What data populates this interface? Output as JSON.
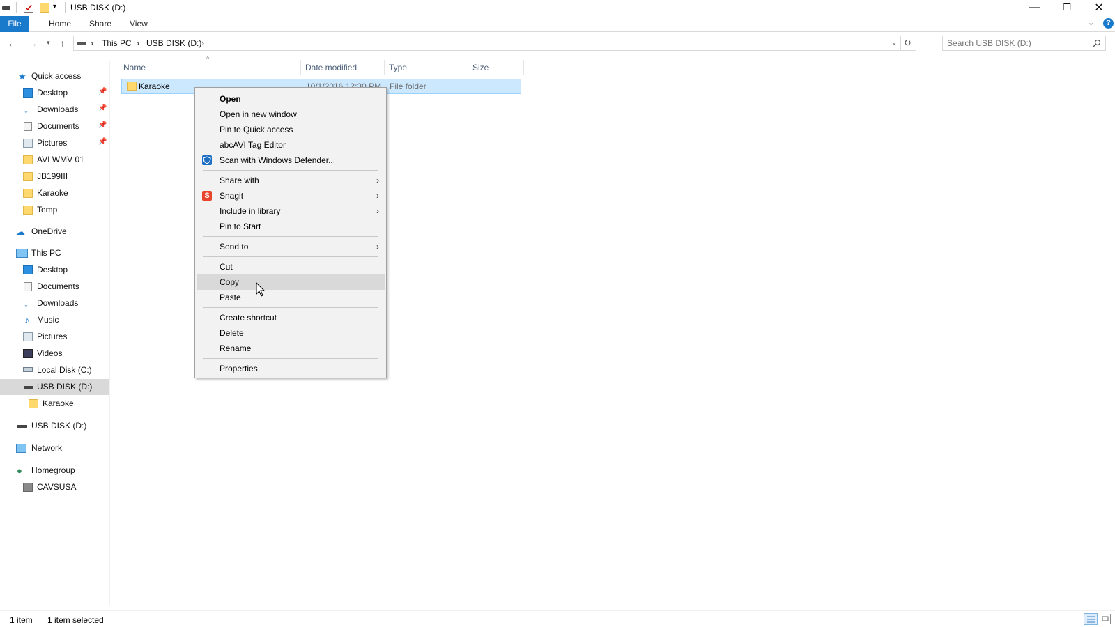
{
  "window": {
    "title": "USB DISK (D:)",
    "minimize": "—",
    "restore": "❐",
    "close": "✕"
  },
  "ribbon": {
    "tabs": [
      "File",
      "Home",
      "Share",
      "View"
    ],
    "help": "?"
  },
  "address": {
    "crumbs": [
      "This PC",
      "USB DISK (D:)"
    ],
    "separator": "›",
    "search_placeholder": "Search USB DISK (D:)"
  },
  "nav": {
    "quick_access": {
      "label": "Quick access",
      "items": [
        {
          "label": "Desktop",
          "icon": "desktop-icon",
          "pinned": true
        },
        {
          "label": "Downloads",
          "icon": "downloads-icon",
          "pinned": true
        },
        {
          "label": "Documents",
          "icon": "documents-icon",
          "pinned": true
        },
        {
          "label": "Pictures",
          "icon": "pictures-icon",
          "pinned": true
        },
        {
          "label": "AVI WMV 01",
          "icon": "folder-icon",
          "pinned": false
        },
        {
          "label": "JB199III",
          "icon": "folder-icon",
          "pinned": false
        },
        {
          "label": "Karaoke",
          "icon": "folder-icon",
          "pinned": false
        },
        {
          "label": "Temp",
          "icon": "folder-icon",
          "pinned": false
        }
      ]
    },
    "onedrive": "OneDrive",
    "this_pc": {
      "label": "This PC",
      "items": [
        {
          "label": "Desktop",
          "icon": "desktop-icon"
        },
        {
          "label": "Documents",
          "icon": "documents-icon"
        },
        {
          "label": "Downloads",
          "icon": "downloads-icon"
        },
        {
          "label": "Music",
          "icon": "music-icon"
        },
        {
          "label": "Pictures",
          "icon": "pictures-icon"
        },
        {
          "label": "Videos",
          "icon": "videos-icon"
        },
        {
          "label": "Local Disk (C:)",
          "icon": "local-disk-icon"
        },
        {
          "label": "USB DISK (D:)",
          "icon": "usb-drive-icon",
          "selected": true
        },
        {
          "label": "Karaoke",
          "icon": "folder-icon"
        }
      ]
    },
    "usb_disk": "USB DISK (D:)",
    "network": "Network",
    "homegroup": "Homegroup",
    "homegroup_user": "CAVSUSA"
  },
  "columns": [
    "Name",
    "Date modified",
    "Type",
    "Size"
  ],
  "files": [
    {
      "name": "Karaoke",
      "date": "10/1/2016 12:30 PM",
      "type": "File folder",
      "size": ""
    }
  ],
  "context_menu": {
    "items": [
      {
        "label": "Open",
        "bold": true
      },
      {
        "label": "Open in new window"
      },
      {
        "label": "Pin to Quick access"
      },
      {
        "label": "abcAVI Tag Editor"
      },
      {
        "label": "Scan with Windows Defender...",
        "icon": "windows-defender-icon"
      },
      {
        "label": "Share with",
        "submenu": true
      },
      {
        "label": "Snagit",
        "submenu": true,
        "icon": "snagit-icon"
      },
      {
        "label": "Include in library",
        "submenu": true
      },
      {
        "label": "Pin to Start"
      },
      {
        "label": "Send to",
        "submenu": true
      },
      {
        "label": "Cut"
      },
      {
        "label": "Copy",
        "hover": true
      },
      {
        "label": "Paste"
      },
      {
        "label": "Create shortcut"
      },
      {
        "label": "Delete"
      },
      {
        "label": "Rename"
      },
      {
        "label": "Properties"
      }
    ],
    "submenu_arrow": "›"
  },
  "status": {
    "count": "1 item",
    "selected": "1 item selected"
  },
  "colors": {
    "accent": "#1979ca",
    "selection": "#cce8ff",
    "menu_bg": "#f2f2f2"
  }
}
